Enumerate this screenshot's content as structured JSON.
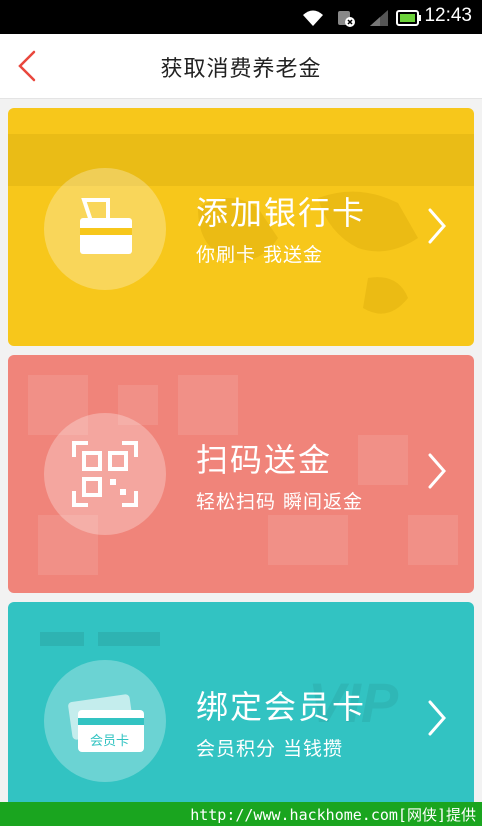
{
  "status_bar": {
    "time": "12:43",
    "icons": [
      "wifi-icon",
      "alarm-icon",
      "signal-icon",
      "battery-icon"
    ]
  },
  "header": {
    "title": "获取消费养老金",
    "back_icon": "chevron-left-icon"
  },
  "cards": [
    {
      "title": "添加银行卡",
      "subtitle": "你刷卡 我送金",
      "icon": "bank-card-icon",
      "color": "#f7c71b"
    },
    {
      "title": "扫码送金",
      "subtitle": "轻松扫码 瞬间返金",
      "icon": "qr-scan-icon",
      "color": "#f0847a"
    },
    {
      "title": "绑定会员卡",
      "subtitle": "会员积分 当钱攒",
      "icon": "member-card-icon",
      "icon_label": "会员卡",
      "color": "#32c3c2"
    }
  ],
  "colors": {
    "accent": "#e9473d",
    "footer": "#1aa51f"
  },
  "footer": {
    "text": "http://www.hackhome.com[网侠]提供"
  }
}
